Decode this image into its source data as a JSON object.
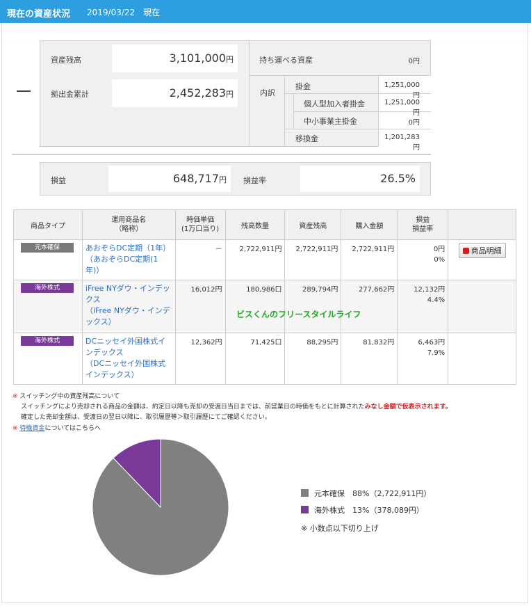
{
  "header": {
    "title": "現在の資産状況",
    "date": "2019/03/22",
    "suffix": "現在"
  },
  "summary": {
    "asset_balance": {
      "label": "資産残高",
      "value": "3,101,000",
      "unit": "円"
    },
    "contribution_total": {
      "label": "拠出金累計",
      "value": "2,452,283",
      "unit": "円"
    },
    "portable_assets": {
      "label": "持ち運べる資産",
      "value": "0円"
    },
    "breakdown_label": "内訳",
    "breakdown": [
      {
        "label": "掛金",
        "value": "1,251,000円"
      },
      {
        "label": "個人型加入者掛金",
        "value": "1,251,000円"
      },
      {
        "label": "中小事業主掛金",
        "value": "0円"
      },
      {
        "label": "移換金",
        "value": "1,201,283円"
      }
    ],
    "profit": {
      "label": "損益",
      "value": "648,717",
      "unit": "円"
    },
    "profit_rate": {
      "label": "損益率",
      "value": "26.5%"
    }
  },
  "table": {
    "headers": [
      "商品タイプ",
      "運用商品名\n（略称）",
      "時価単価\n(1万口当り)",
      "残高数量",
      "資産残高",
      "購入金額",
      "損益\n損益率",
      ""
    ],
    "rows": [
      {
        "type": "元本確保",
        "type_color": "#7a7a7a",
        "name": "あおぞらDC定期（1年）",
        "short": "（あおぞらDC定期(1年)）",
        "unit_price": "－",
        "quantity": "2,722,911円",
        "balance": "2,722,911円",
        "purchase": "2,722,911円",
        "profit": "0円",
        "rate": "0%",
        "detail_button": "商品明細"
      },
      {
        "type": "海外株式",
        "type_color": "#7a3a9a",
        "name": "iFree NYダウ・インデックス",
        "short": "（iFree NYダウ・インデックス）",
        "unit_price": "16,012円",
        "quantity": "180,986口",
        "balance": "289,794円",
        "purchase": "277,662円",
        "profit": "12,132円",
        "rate": "4.4%",
        "detail_button": ""
      },
      {
        "type": "海外株式",
        "type_color": "#7a3a9a",
        "name": "DCニッセイ外国株式インデックス",
        "short": "（DCニッセイ外国株式インデックス）",
        "unit_price": "12,362円",
        "quantity": "71,425口",
        "balance": "88,295円",
        "purchase": "81,832円",
        "profit": "6,463円",
        "rate": "7.9%",
        "detail_button": ""
      }
    ]
  },
  "watermark": "ビスくんのフリースタイルライフ",
  "notes": {
    "mark": "※",
    "switching_title": "スイッチング中の資産残高について",
    "line1_a": "スイッチングにより売却される商品の金額は、約定日以降も売却の受渡日当日までは、前営業日の時価をもとに計算された",
    "line1_b": "みなし金額で仮表示されます。",
    "line2": "確定した売却金額は、受渡日の翌日以降に、取引履歴等＞取引履歴にてご確認ください。",
    "standby_link": "待機資金",
    "standby_rest": "についてはこちらへ"
  },
  "chart_data": {
    "type": "pie",
    "categories": [
      "元本確保",
      "海外株式"
    ],
    "values": [
      2722911,
      378089
    ],
    "percent_labels": [
      "88%",
      "13%"
    ],
    "colors": [
      "#808080",
      "#7a3a9a"
    ]
  },
  "legend": {
    "items": [
      {
        "label": "元本確保",
        "detail": "88%（2,722,911円）",
        "color": "#808080"
      },
      {
        "label": "海外株式",
        "detail": "13%（378,089円）",
        "color": "#7a3a9a"
      }
    ],
    "note": "※ 小数点以下切り上げ"
  }
}
